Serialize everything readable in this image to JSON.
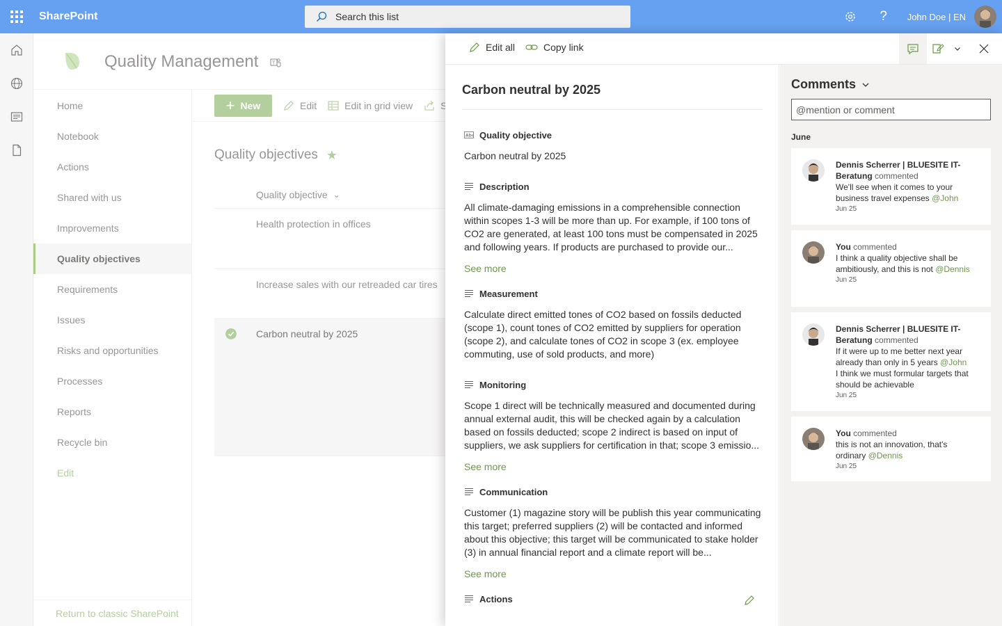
{
  "topbar": {
    "brand": "SharePoint",
    "search_placeholder": "Search this list",
    "user": "John Doe | EN"
  },
  "site": {
    "title": "Quality Management"
  },
  "nav": {
    "items": [
      "Home",
      "Notebook",
      "Actions",
      "Shared with us",
      "Improvements",
      "Quality objectives",
      "Requirements",
      "Issues",
      "Risks and opportunities",
      "Processes",
      "Reports",
      "Recycle bin"
    ],
    "selected": "Quality objectives",
    "edit": "Edit",
    "footer": "Return to classic SharePoint"
  },
  "commands": {
    "new": "New",
    "edit": "Edit",
    "grid": "Edit in grid view",
    "share": "S"
  },
  "list": {
    "title": "Quality objectives",
    "column": "Quality objective",
    "rows": [
      "Health protection in offices",
      "Increase sales with our retreaded car tires",
      "Carbon neutral by 2025"
    ]
  },
  "panel": {
    "edit_all": "Edit all",
    "copy_link": "Copy link",
    "title": "Carbon neutral by 2025",
    "see_more": "See more",
    "fields": {
      "objective": {
        "label": "Quality objective",
        "value": "Carbon neutral by 2025"
      },
      "description": {
        "label": "Description",
        "value": "All climate-damaging emissions in a comprehensible connection within scopes 1-3 will be more than up. For example, if 100 tons of CO2 are generated, at least 100 tons must be compensated in 2025 and following years. If products are purchased to provide our..."
      },
      "measurement": {
        "label": "Measurement",
        "value": "Calculate direct emitted tones of CO2 based on fossils deducted (scope 1), count tones of CO2 emitted by suppliers for operation (scope 2), and calculate tones of CO2 in scope 3 (ex. employee commuting, use of sold products, and more)"
      },
      "monitoring": {
        "label": "Monitoring",
        "value": "Scope 1 direct will be technically measured and documented during annual external audit, this will be checked again by a calculation based on fossils deducted; scope 2 indirect is based on input of suppliers, we ask suppliers for certification in that; scope 3 emissio..."
      },
      "communication": {
        "label": "Communication",
        "value": "Customer (1) magazine story will be publish this year communicating this target; preferred suppliers (2) will be contacted and informed about this objective; this target will be communicated to stake holder (3) in annual financial report and a climate report will be..."
      },
      "actions": {
        "label": "Actions"
      }
    }
  },
  "comments": {
    "title": "Comments",
    "placeholder": "@mention or comment",
    "month": "June",
    "verb": "commented",
    "items": [
      {
        "author": "Dennis Scherrer | BLUESITE IT-Beratung",
        "text": "We'll see when it comes to your business travel expenses",
        "mention": "@John",
        "text2": "",
        "date": "Jun 25"
      },
      {
        "author": "You",
        "text": "I think a quality objective shall be ambitiously, and this is not",
        "mention": "@Dennis",
        "text2": "",
        "date": "Jun 25"
      },
      {
        "author": "Dennis Scherrer | BLUESITE IT-Beratung",
        "text": "If it were up to me better next year already than only in 5 years",
        "mention": "@John",
        "text2": "I think we must formular targets that should be achievable",
        "date": "Jun 25"
      },
      {
        "author": "You",
        "text": "this is not an innovation, that's ordinary",
        "mention": "@Dennis",
        "text2": "",
        "date": "Jun 25"
      }
    ]
  },
  "colors": {
    "topbar": "#66a0f0",
    "accent": "#8bb56b",
    "link": "#6a9a45"
  }
}
